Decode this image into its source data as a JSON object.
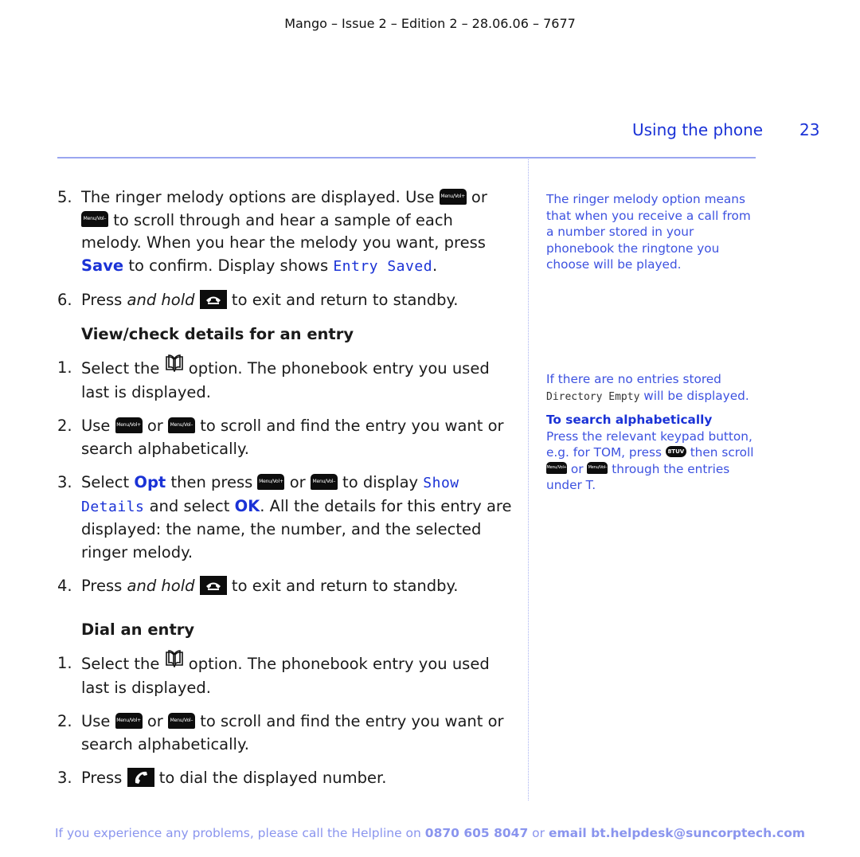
{
  "header": {
    "doc_ref": "Mango – Issue 2 – Edition 2 – 28.06.06 – 7677",
    "section_title": "Using the phone",
    "page_number": "23"
  },
  "keys": {
    "vol_up": "Menu/Vol+",
    "vol_down": "Menu/Vol–",
    "key8": "8TUV"
  },
  "main": {
    "ringer_steps": [
      {
        "num": "5.",
        "t1": "The ringer melody options are displayed. Use",
        "t2": "or",
        "t3": "to scroll through and hear a sample of each melody. When you hear the melody you want, press",
        "save": "Save",
        "t4": "to confirm. Display shows",
        "lcd": "Entry Saved",
        "t5": "."
      },
      {
        "num": "6.",
        "t1": "Press",
        "em": "and hold",
        "t2": "to exit and return to standby."
      }
    ],
    "view_section": {
      "heading": "View/check details for an entry",
      "steps": [
        {
          "num": "1.",
          "t1": "Select the",
          "t2": "option. The phonebook entry you used last is displayed."
        },
        {
          "num": "2.",
          "t1": "Use",
          "t2": "or",
          "t3": "to scroll and find the entry you want or search alphabetically."
        },
        {
          "num": "3.",
          "t1": "Select",
          "opt": "Opt",
          "t2": "then press",
          "t3": "or",
          "t4": "to display",
          "lcd": "Show Details",
          "t5": "and select",
          "ok": "OK",
          "t6": ". All the details for this entry are displayed: the name, the number, and the selected ringer melody."
        },
        {
          "num": "4.",
          "t1": "Press",
          "em": "and hold",
          "t2": "to exit and return to standby."
        }
      ]
    },
    "dial_section": {
      "heading": "Dial an entry",
      "steps": [
        {
          "num": "1.",
          "t1": "Select the",
          "t2": "option. The phonebook entry you used last is displayed."
        },
        {
          "num": "2.",
          "t1": "Use",
          "t2": "or",
          "t3": "to scroll and find the entry you want or search alphabetically."
        },
        {
          "num": "3.",
          "t1": "Press",
          "t2": "to dial the displayed number."
        }
      ]
    }
  },
  "sidebar": {
    "note1": "The ringer melody option means that when you receive a call from a number stored in your phonebook the ringtone you choose will be played.",
    "note2_a": "If there are no entries stored",
    "note2_lcd": "Directory Empty",
    "note2_b": "will be displayed.",
    "search_heading": "To search alphabetically",
    "search_a": "Press the relevant keypad button, e.g. for TOM, press",
    "search_b": "then scroll",
    "search_or": "or",
    "search_c": "through the entries under T."
  },
  "footer": {
    "t1": "If you experience any problems, please call the Helpline on",
    "phone": "0870 605 8047",
    "t2": "or",
    "email": "email bt.helpdesk@suncorptech.com"
  },
  "colors": {
    "accent": "#1a32d6",
    "sidebar_text": "#3d52e0",
    "rule": "#9aa6f0",
    "footer_text": "#8a95ee"
  }
}
